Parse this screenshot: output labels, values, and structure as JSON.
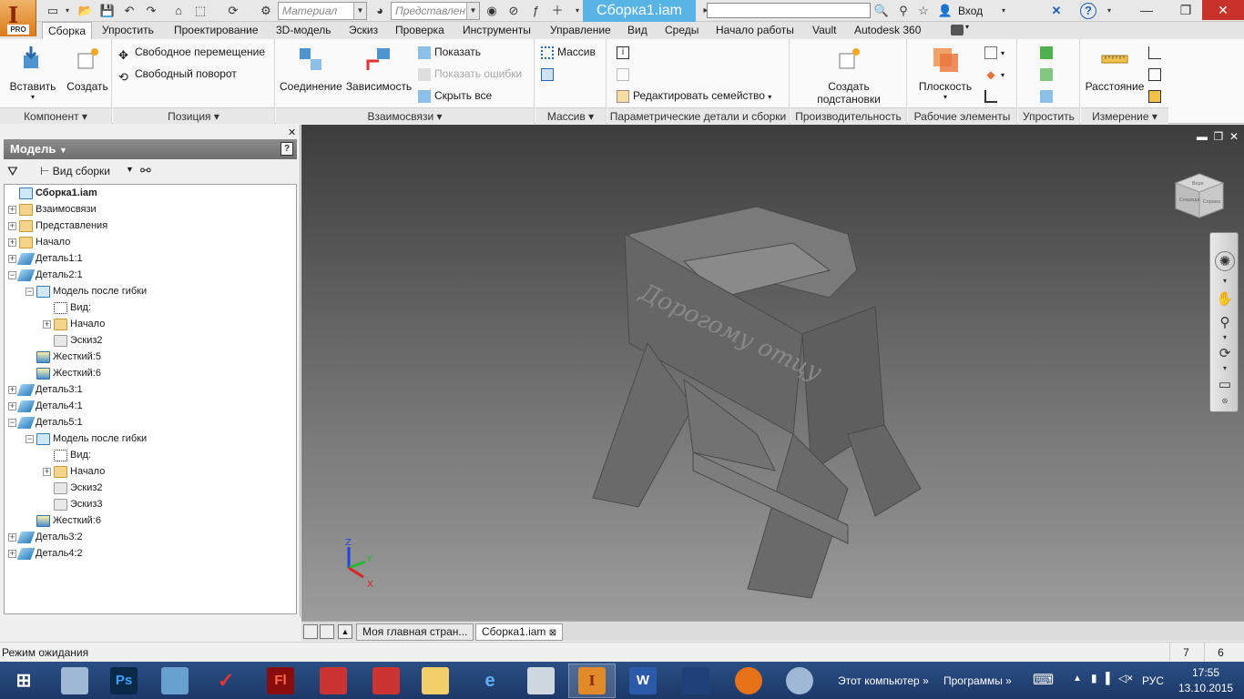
{
  "titlebar": {
    "material_placeholder": "Материал",
    "representation_placeholder": "Представлен",
    "document_title": "Сборка1.iam",
    "signin_label": "Вход",
    "help_label": "?",
    "app_badge": "PRO"
  },
  "ribbon_tabs": [
    "Сборка",
    "Упростить",
    "Проектирование",
    "3D-модель",
    "Эскиз",
    "Проверка",
    "Инструменты",
    "Управление",
    "Вид",
    "Среды",
    "Начало работы",
    "Vault",
    "Autodesk 360"
  ],
  "ribbon": {
    "component": {
      "insert": "Вставить",
      "create": "Создать",
      "title": "Компонент"
    },
    "position": {
      "free_move": "Свободное перемещение",
      "free_rotate": "Свободный поворот",
      "title": "Позиция"
    },
    "relationships": {
      "joint": "Соединение",
      "constrain": "Зависимость",
      "show": "Показать",
      "show_errors": "Показать ошибки",
      "hide_all": "Скрыть все",
      "title": "Взаимосвязи"
    },
    "pattern": {
      "pattern": "Массив",
      "title": "Массив"
    },
    "params": {
      "edit_family": "Редактировать семейство",
      "title": "Параметрические детали и сборки"
    },
    "productivity": {
      "create_sub_line1": "Создать",
      "create_sub_line2": "подстановки",
      "title": "Производительность"
    },
    "work_features": {
      "plane": "Плоскость",
      "title": "Рабочие элементы"
    },
    "simplify": {
      "title": "Упростить"
    },
    "measure": {
      "distance": "Расстояние",
      "title": "Измерение"
    }
  },
  "browser": {
    "header": "Модель",
    "view_selector": "Вид сборки",
    "help_icon": "?",
    "tree": [
      {
        "label": "Сборка1.iam",
        "icon": "asm",
        "depth": 0,
        "expander": "",
        "bold": true
      },
      {
        "label": "Взаимосвязи",
        "icon": "folder",
        "depth": 0,
        "expander": "+"
      },
      {
        "label": "Представления",
        "icon": "folder",
        "depth": 0,
        "expander": "+"
      },
      {
        "label": "Начало",
        "icon": "folder",
        "depth": 0,
        "expander": "+"
      },
      {
        "label": "Деталь1:1",
        "icon": "part",
        "depth": 0,
        "expander": "+"
      },
      {
        "label": "Деталь2:1",
        "icon": "part",
        "depth": 0,
        "expander": "-"
      },
      {
        "label": "Модель после гибки",
        "icon": "asm",
        "depth": 1,
        "expander": "-"
      },
      {
        "label": "Вид:",
        "icon": "view",
        "depth": 2,
        "expander": ""
      },
      {
        "label": "Начало",
        "icon": "folder",
        "depth": 2,
        "expander": "+"
      },
      {
        "label": "Эскиз2",
        "icon": "sketch",
        "depth": 2,
        "expander": ""
      },
      {
        "label": "Жесткий:5",
        "icon": "flat",
        "depth": 1,
        "expander": ""
      },
      {
        "label": "Жесткий:6",
        "icon": "flat",
        "depth": 1,
        "expander": ""
      },
      {
        "label": "Деталь3:1",
        "icon": "part",
        "depth": 0,
        "expander": "+"
      },
      {
        "label": "Деталь4:1",
        "icon": "part",
        "depth": 0,
        "expander": "+"
      },
      {
        "label": "Деталь5:1",
        "icon": "part",
        "depth": 0,
        "expander": "-"
      },
      {
        "label": "Модель после гибки",
        "icon": "asm",
        "depth": 1,
        "expander": "-"
      },
      {
        "label": "Вид:",
        "icon": "view",
        "depth": 2,
        "expander": ""
      },
      {
        "label": "Начало",
        "icon": "folder",
        "depth": 2,
        "expander": "+"
      },
      {
        "label": "Эскиз2",
        "icon": "sketch",
        "depth": 2,
        "expander": ""
      },
      {
        "label": "Эскиз3",
        "icon": "sketch",
        "depth": 2,
        "expander": ""
      },
      {
        "label": "Жесткий:6",
        "icon": "flat",
        "depth": 1,
        "expander": ""
      },
      {
        "label": "Деталь3:2",
        "icon": "part",
        "depth": 0,
        "expander": "+"
      },
      {
        "label": "Деталь4:2",
        "icon": "part",
        "depth": 0,
        "expander": "+"
      }
    ]
  },
  "viewport": {
    "model_inscription": "Дорогому отцу",
    "viewcube_faces": [
      "Верх",
      "Справа",
      "Спереди"
    ],
    "axis_labels": {
      "x": "X",
      "y": "Y",
      "z": "Z"
    }
  },
  "doc_tabs": [
    "Моя главная стран...",
    "Сборка1.iam"
  ],
  "status": {
    "text": "Режим ожидания",
    "count1": "7",
    "count2": "6"
  },
  "taskbar": {
    "this_pc": "Этот компьютер",
    "programs": "Программы",
    "lang": "РУС",
    "time": "17:55",
    "date": "13.10.2015"
  },
  "colors": {
    "accent": "#59b4e6",
    "taskbar": "#1c3868",
    "close": "#c7322b"
  }
}
